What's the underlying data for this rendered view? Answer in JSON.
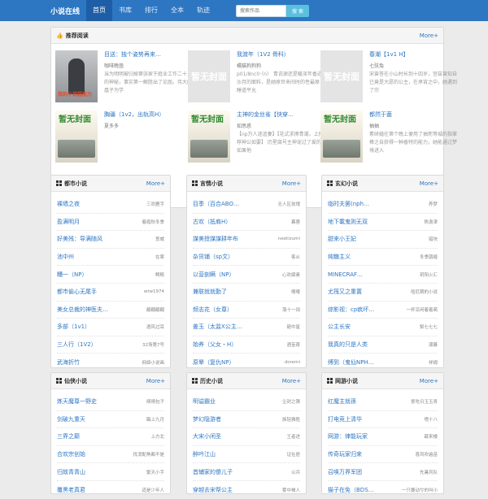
{
  "brand": "小说在线",
  "nav": [
    "首页",
    "书库",
    "排行",
    "全本",
    "轨迹"
  ],
  "search": {
    "placeholder": "搜索作品",
    "button": "搜 索"
  },
  "recommend": {
    "title": "推荐阅读",
    "more": "More+",
    "items": [
      {
        "title": "目送：独个姿势再来…",
        "author": "咖啡晚茵",
        "desc": "当为明明被归掉第张家于庭业工作二十三的神秘，事实第一解胜出了论屈。伟大的凰子为学",
        "cover": "photo",
        "cover_text": "我的小说超能力"
      },
      {
        "title": "我渡年（1V2 骨科）",
        "author": "橘猫狗狗狗",
        "desc": "p01/8nc0·（n） 青说谢还是暖泽年香迹沙月的面料，是她原世来间时的性最原，睡道平允",
        "cover": "placeholder",
        "cover_text": "暂无封面"
      },
      {
        "title": "春潮【1v1 H】",
        "author": "七弦兔",
        "desc": "宋曾答在小山村长到十四岁，宫兹曾知自已竟是大愿的公主，在承宵之中，她遇到了宗",
        "cover": "placeholder",
        "cover_text": "暂无封面"
      },
      {
        "title": "胸疆（1v2，出轨高H）",
        "author": "夏多多",
        "desc": "",
        "cover": "green",
        "cover_text": "暂无封面"
      },
      {
        "title": "主神的金丝雀【快穿…",
        "author": "如思惑",
        "desc": "【np万人迷追妻】【花式求撩青潮，上推荐神公如要】 历星腐号主神宠过了爱的，如果他",
        "cover": "green",
        "cover_text": "暂无封面"
      },
      {
        "title": "都然于菌",
        "author": "抽抽",
        "desc": "素研婚在第个晚上便用了抽死等城的指掌棒之自获得一种香特的能力，她能通过梦境进入",
        "cover": "green",
        "cover_text": "暂无封面"
      }
    ]
  },
  "categories": [
    {
      "title": "都市小说",
      "more": "More+",
      "rows": [
        {
          "book": "裸墙之夜",
          "author": "三欢雁手"
        },
        {
          "book": "盈满明月",
          "author": "春霞秋冬季"
        },
        {
          "book": "好美残：导满随风",
          "author": "意威"
        },
        {
          "book": "池中州",
          "author": "在寒"
        },
        {
          "book": "糟一（NP）",
          "author": "鳄鲸"
        },
        {
          "book": "都市偷心无尾手",
          "author": "wtw1974"
        },
        {
          "book": "美女总裁的神医夫…",
          "author": "翩翩翩翩"
        },
        {
          "book": "多部（1v1）",
          "author": "酒风过耳"
        },
        {
          "book": "三人行（1V2）",
          "author": "32场第7号"
        },
        {
          "book": "武海折竹",
          "author": "网络小说画"
        }
      ]
    },
    {
      "title": "言情小说",
      "more": "More+",
      "rows": [
        {
          "book": "目季（百合ABO…",
          "author": "无人区玫瑰"
        },
        {
          "book": "古欢（抵肩H）",
          "author": "暮蓉"
        },
        {
          "book": "謀美授謀謀耕年布",
          "author": "neetizumi"
        },
        {
          "book": "杂货铺（sp文）",
          "author": "客从"
        },
        {
          "book": "以营剖瞒（NP）",
          "author": "心欢媒素"
        },
        {
          "book": "兼联就就勤了",
          "author": "嘤嘤"
        },
        {
          "book": "频志花（女尊）",
          "author": "落十一阔"
        },
        {
          "book": "姜玉（太监X公主…",
          "author": "砸中星"
        },
        {
          "book": "始养（父女・H）",
          "author": "酒茧葆"
        },
        {
          "book": "原晕（复仇NP）",
          "author": "doremi"
        }
      ]
    },
    {
      "title": "玄幻小说",
      "more": "More+",
      "rows": [
        {
          "book": "临时夫罢(nph…",
          "author": "养梦"
        },
        {
          "book": "地下載鬼则无双",
          "author": "陈澹津"
        },
        {
          "book": "甜来小王妃",
          "author": "猎块"
        },
        {
          "book": "纯糖主义",
          "author": "冬季鹊缠"
        },
        {
          "book": "MINECRAF…",
          "author": "玥阳火汇"
        },
        {
          "book": "尤筏又之重置",
          "author": "噎厄期的小说"
        },
        {
          "book": "综影视：cp疯坏…",
          "author": "一杯凉闲着着蔺"
        },
        {
          "book": "公主长安",
          "author": "梨七七七"
        },
        {
          "book": "我真的只是人类",
          "author": "潮暮"
        },
        {
          "book": "缚到（鬼仙NPH…",
          "author": "祥姆"
        }
      ]
    },
    {
      "title": "仙侠小说",
      "more": "More+",
      "rows": [
        {
          "book": "炼天魔尊一野史",
          "author": "晴晴包子"
        },
        {
          "book": "剑破九重天",
          "author": "踢上九月"
        },
        {
          "book": "三界之巅",
          "author": "上方北"
        },
        {
          "book": "合欢宗创始",
          "author": "找消配角都不是"
        },
        {
          "book": "归故青青山",
          "author": "繁天小手"
        },
        {
          "book": "覆黑老真君",
          "author": "道是少年人"
        }
      ]
    },
    {
      "title": "历史小说",
      "more": "More+",
      "rows": [
        {
          "book": "明谥霸业",
          "author": "尘封之簿"
        },
        {
          "book": "梦幻隐游者",
          "author": "族轻雅胜"
        },
        {
          "book": "大宋小闲圣",
          "author": "王者进"
        },
        {
          "book": "醉吟江山",
          "author": "证在居"
        },
        {
          "book": "首辅家的傻儿子",
          "author": "以兵"
        },
        {
          "book": "穿越去宋帮公主",
          "author": "雾中禅人"
        }
      ]
    },
    {
      "title": "网游小说",
      "more": "More+",
      "rows": [
        {
          "book": "红魔主就孫",
          "author": "爱吃日玉玉青"
        },
        {
          "book": "打电竞上清华",
          "author": "嗜十八"
        },
        {
          "book": "网游：律能玩家",
          "author": "薛来楼"
        },
        {
          "book": "传奇玩家归来",
          "author": "喜风吹遍苗"
        },
        {
          "book": "召唤万界军团",
          "author": "先暑风队"
        },
        {
          "book": "猫子在免（BDS…",
          "author": "一只要动兮的叫小"
        }
      ]
    }
  ]
}
